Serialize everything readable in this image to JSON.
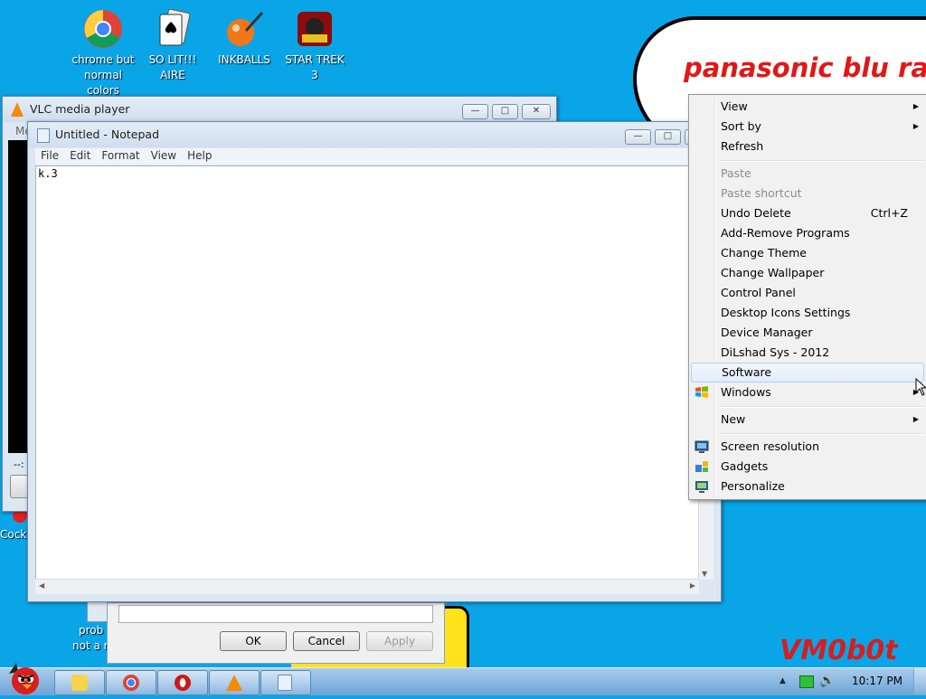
{
  "desktop": {
    "icons": [
      {
        "label": "chrome but normal colors",
        "lines": [
          "chrome but",
          "normal",
          "colors"
        ],
        "icon": "chrome-icon"
      },
      {
        "label": "SO LIT!!! AIRE",
        "lines": [
          "SO LIT!!!",
          "AIRE"
        ],
        "icon": "solitaire-icon"
      },
      {
        "label": "INKBALLS",
        "lines": [
          "INKBALLS"
        ],
        "icon": "inkball-icon"
      },
      {
        "label": "STAR TREK 3",
        "lines": [
          "STAR TREK",
          "3"
        ],
        "icon": "star-wars-game-icon"
      }
    ],
    "partial_labels": {
      "cock": "Cock",
      "prob": "prob",
      "not_a": "not a r"
    },
    "cloud_text": "panasonic blu ray",
    "watermark": "VM0b0t"
  },
  "vlc": {
    "title": "VLC media player",
    "menu_fragment": "Me",
    "time_fragment": "--:"
  },
  "notepad": {
    "title": "Untitled - Notepad",
    "menu": [
      "File",
      "Edit",
      "Format",
      "View",
      "Help"
    ],
    "content": "k.3"
  },
  "dialog": {
    "ok": "OK",
    "cancel": "Cancel",
    "apply": "Apply"
  },
  "context_menu": {
    "view": "View",
    "sort_by": "Sort by",
    "refresh": "Refresh",
    "paste": "Paste",
    "paste_shortcut": "Paste shortcut",
    "undo_delete": "Undo Delete",
    "undo_shortcut": "Ctrl+Z",
    "add_remove": "Add-Remove Programs",
    "change_theme": "Change Theme",
    "change_wallpaper": "Change Wallpaper",
    "control_panel": "Control Panel",
    "desktop_icons": "Desktop Icons Settings",
    "device_manager": "Device Manager",
    "dilshad": "DiLshad Sys - 2012",
    "software": "Software",
    "windows": "Windows",
    "new": "New",
    "screen_resolution": "Screen resolution",
    "gadgets": "Gadgets",
    "personalize": "Personalize"
  },
  "taskbar": {
    "clock": "10:17 PM",
    "buttons": [
      "explorer-icon",
      "chrome-icon",
      "opera-icon",
      "vlc-icon",
      "notepad-icon"
    ]
  },
  "colors": {
    "desktop": "#0aa5e6",
    "cloud_text": "#e01818",
    "watermark": "#d41f1f"
  }
}
